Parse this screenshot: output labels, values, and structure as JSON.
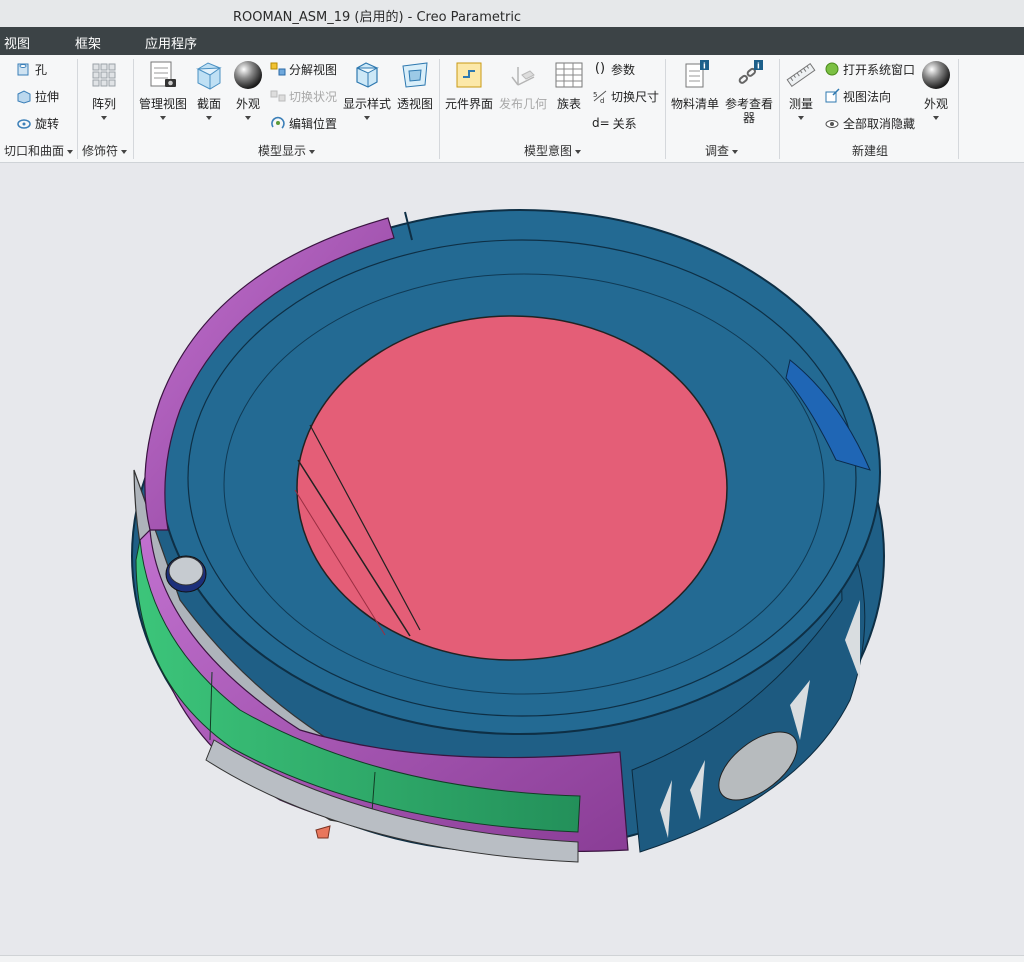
{
  "window": {
    "title": "ROOMAN_ASM_19 (启用的) - Creo Parametric"
  },
  "menu": {
    "items": [
      "视图",
      "框架",
      "应用程序"
    ]
  },
  "ribbon": {
    "cut_group": {
      "label": "切口和曲面",
      "hole": "孔",
      "extrude": "拉伸",
      "revolve": "旋转"
    },
    "modifier_group": {
      "label": "修饰符",
      "pattern": "阵列"
    },
    "display_group": {
      "label": "模型显示",
      "manage_views": "管理视图",
      "section": "截面",
      "appearance": "外观",
      "exploded_view": "分解视图",
      "toggle_status": "切换状况",
      "edit_position": "编辑位置",
      "display_style": "显示样式",
      "perspective": "透视图"
    },
    "intent_group": {
      "label": "模型意图",
      "component_interface": "元件界面",
      "publish_geometry": "发布几何",
      "family_table": "族表",
      "parameters": "参数",
      "switch_dimensions": "切换尺寸",
      "relations": "关系",
      "relations_prefix": "d="
    },
    "investigate_group": {
      "label": "调查",
      "bom": "物料清单",
      "reference_viewer_l1": "参考查看",
      "reference_viewer_l2": "器"
    },
    "new_group": {
      "label": "新建组",
      "measure": "测量",
      "open_system_window": "打开系统窗口",
      "view_normal": "视图法向",
      "unhide_all": "全部取消隐藏",
      "appearance": "外观"
    }
  },
  "colors": {
    "title_bg": "#e6e8ea",
    "menu_bg": "#3c4346",
    "ribbon_bg": "#f6f7f8",
    "viewport_bg": "#e7e8ec",
    "lid_blue": "#236a93",
    "top_pink": "#e45e77",
    "bumper_purple": "#a653b3",
    "side_green": "#2fa866"
  },
  "icons": [
    "hole-icon",
    "extrude-icon",
    "revolve-icon",
    "pattern-icon",
    "manage-views-icon",
    "section-icon",
    "appearance-sphere-icon",
    "exploded-view-icon",
    "toggle-status-icon",
    "edit-position-icon",
    "display-style-icon",
    "perspective-icon",
    "component-interface-icon",
    "publish-geometry-icon",
    "family-table-icon",
    "parameters-icon",
    "switch-dimensions-icon",
    "relations-icon",
    "bom-icon",
    "reference-viewer-icon",
    "measure-icon",
    "system-window-icon",
    "view-normal-icon",
    "unhide-all-icon",
    "appearance-sphere-icon"
  ]
}
